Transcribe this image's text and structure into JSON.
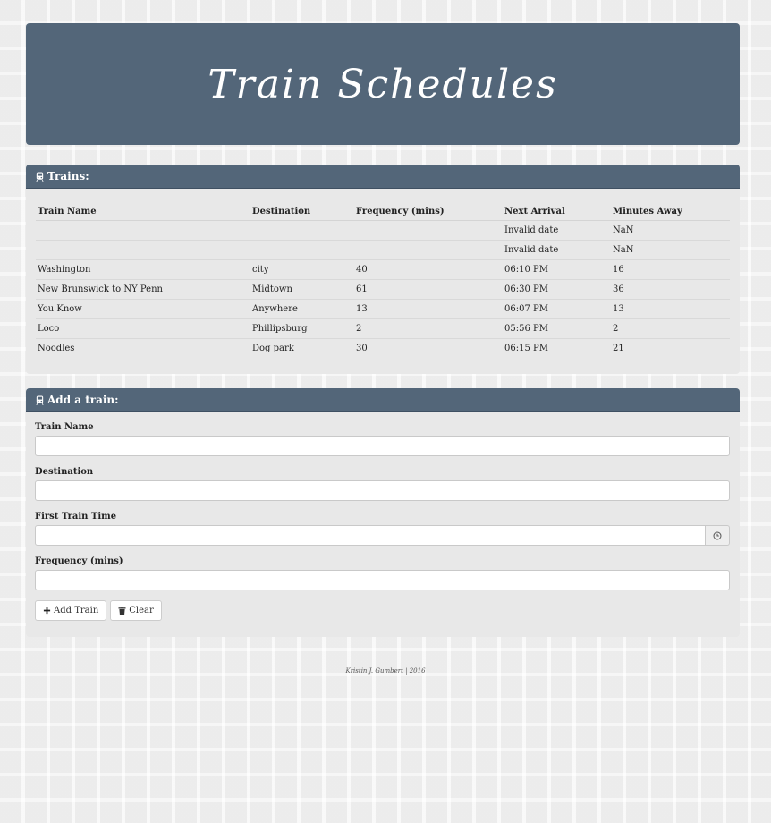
{
  "header": {
    "title": "Train Schedules"
  },
  "trains_panel": {
    "heading": "Trains:",
    "icon": "train-icon",
    "columns": [
      "Train Name",
      "Destination",
      "Frequency (mins)",
      "Next Arrival",
      "Minutes Away"
    ],
    "rows": [
      [
        "",
        "",
        "",
        "Invalid date",
        "NaN"
      ],
      [
        "",
        "",
        "",
        "Invalid date",
        "NaN"
      ],
      [
        "Washington",
        "city",
        "40",
        "06:10 PM",
        "16"
      ],
      [
        "New Brunswick to NY Penn",
        "Midtown",
        "61",
        "06:30 PM",
        "36"
      ],
      [
        "You Know",
        "Anywhere",
        "13",
        "06:07 PM",
        "13"
      ],
      [
        "Loco",
        "Phillipsburg",
        "2",
        "05:56 PM",
        "2"
      ],
      [
        "Noodles",
        "Dog park",
        "30",
        "06:15 PM",
        "21"
      ]
    ]
  },
  "add_panel": {
    "heading": "Add a train:",
    "icon": "train-icon",
    "fields": {
      "train_name": {
        "label": "Train Name",
        "value": ""
      },
      "destination": {
        "label": "Destination",
        "value": ""
      },
      "first_train_time": {
        "label": "First Train Time",
        "value": "",
        "addon_icon": "clock-icon"
      },
      "frequency": {
        "label": "Frequency (mins)",
        "value": ""
      }
    },
    "buttons": {
      "add": {
        "label": "Add Train",
        "icon": "plus-icon"
      },
      "clear": {
        "label": "Clear",
        "icon": "trash-icon"
      }
    }
  },
  "footer": {
    "text": "Kristin J. Gumbert | 2016"
  },
  "colors": {
    "panel_header": "#536679",
    "panel_body": "#e8e8e8"
  }
}
